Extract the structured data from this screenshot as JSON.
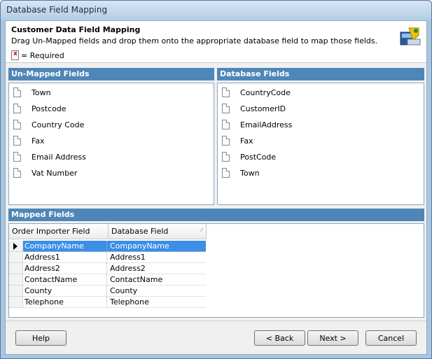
{
  "window": {
    "title": "Database Field Mapping"
  },
  "header": {
    "title": "Customer Data Field Mapping",
    "description": "Drag Un-Mapped fields and drop them onto the appropriate database field to map those fields.",
    "required_legend": "= Required"
  },
  "unmapped": {
    "title": "Un-Mapped Fields",
    "items": [
      "Town",
      "Postcode",
      "Country Code",
      "Fax",
      "Email Address",
      "Vat Number"
    ]
  },
  "database": {
    "title": "Database Fields",
    "items": [
      "CountryCode",
      "CustomerID",
      "EmailAddress",
      "Fax",
      "PostCode",
      "Town"
    ]
  },
  "mapped": {
    "title": "Mapped Fields",
    "columns": [
      "Order Importer Field",
      "Database Field"
    ],
    "rows": [
      [
        "CompanyName",
        "CompanyName"
      ],
      [
        "Address1",
        "Address1"
      ],
      [
        "Address2",
        "Address2"
      ],
      [
        "ContactName",
        "ContactName"
      ],
      [
        "County",
        "County"
      ],
      [
        "Telephone",
        "Telephone"
      ]
    ]
  },
  "buttons": {
    "help": "Help",
    "back": "< Back",
    "next": "Next >",
    "cancel": "Cancel"
  },
  "colors": {
    "panel_header": "#4f86b8",
    "selected_row": "#3c8ee6"
  }
}
